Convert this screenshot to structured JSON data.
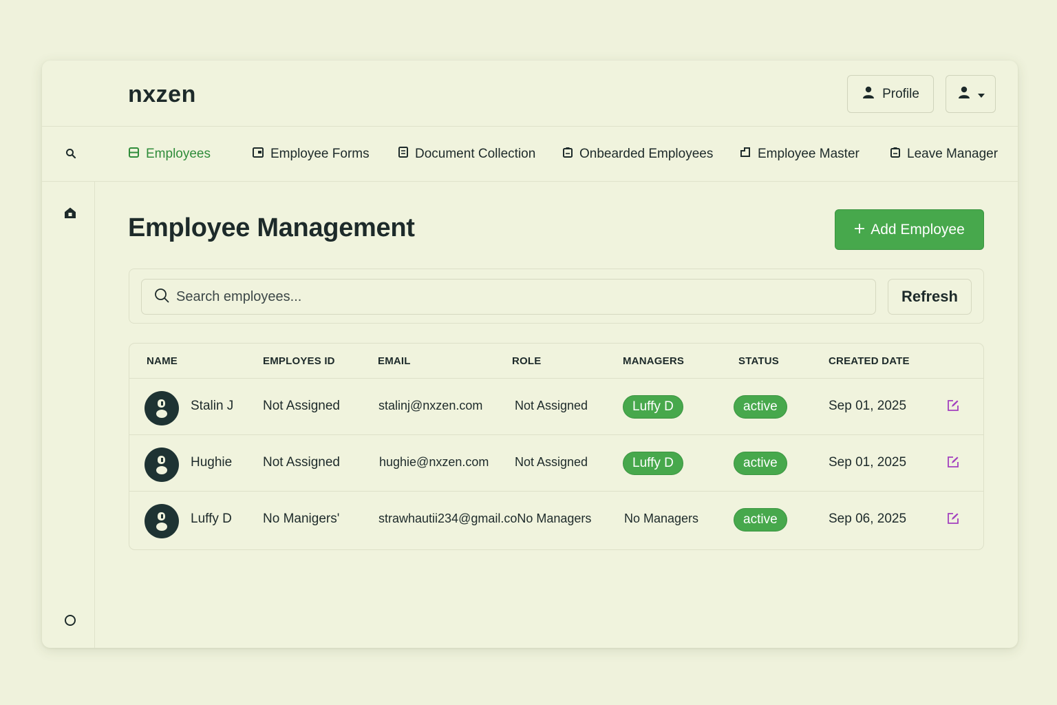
{
  "app": {
    "brand": "nxzen"
  },
  "header": {
    "profile_label": "Profile"
  },
  "nav": {
    "items": [
      {
        "label": "Employees",
        "icon": "list-icon"
      },
      {
        "label": "Employee Forms",
        "icon": "form-icon"
      },
      {
        "label": "Document Collection",
        "icon": "document-icon"
      },
      {
        "label": "Onbearded Employees",
        "icon": "badge-icon"
      },
      {
        "label": "Employee Master",
        "icon": "master-icon"
      },
      {
        "label": "Leave Manager",
        "icon": "calendar-icon"
      }
    ]
  },
  "page": {
    "title": "Employee Management",
    "add_button": "Add Employee",
    "search_placeholder": "Search employees...",
    "refresh_label": "Refresh"
  },
  "table": {
    "columns": [
      "NAME",
      "EMPLOYES ID",
      "EMAIL",
      "ROLE",
      "MANAGERS",
      "STATUS",
      "CREATED DATE"
    ],
    "rows": [
      {
        "name": "Stalin J",
        "employee_id": "Not Assigned",
        "email": "stalinj@nxzen.com",
        "role": "Not Assigned",
        "managers": "Luffy D",
        "status": "active",
        "created": "Sep 01, 2025"
      },
      {
        "name": "Hughie",
        "employee_id": "Not Assigned",
        "email": "hughie@nxzen.com",
        "role": "Not Assigned",
        "managers": "Luffy D",
        "status": "active",
        "created": "Sep 01, 2025"
      },
      {
        "name": "Luffy D",
        "employee_id": "No Manigers'",
        "email": "strawhautii234@gmail.coNo Managers",
        "role": "No Managers",
        "managers": "",
        "status": "active",
        "created": "Sep 06, 2025"
      }
    ]
  },
  "colors": {
    "accent": "#47a84c",
    "background": "#eff2dc",
    "edit_icon": "#a23fbf"
  }
}
